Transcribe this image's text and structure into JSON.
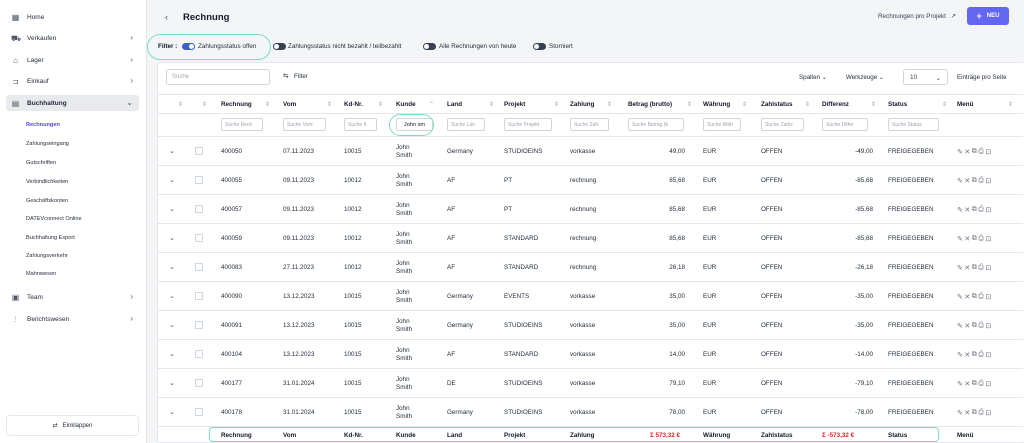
{
  "sidebar": {
    "items": [
      {
        "label": "Home",
        "icon": "grid-icon"
      },
      {
        "label": "Verkaufen",
        "icon": "cart-icon"
      },
      {
        "label": "Lager",
        "icon": "box-icon"
      },
      {
        "label": "Einkauf",
        "icon": "tag-icon"
      },
      {
        "label": "Buchhaltung",
        "icon": "ledger-icon"
      },
      {
        "label": "Team",
        "icon": "team-icon"
      },
      {
        "label": "Berichtswesen",
        "icon": "chart-icon"
      }
    ],
    "subitems": [
      "Rechnungen",
      "Zahlungseingang",
      "Gutschriften",
      "Verbindlichkeiten",
      "Geschäftskonten",
      "DATEVconnect Online",
      "Buchhaltung Export",
      "Zahlungsverkehr",
      "Mahnwesen"
    ],
    "collapse_label": "Einklappen"
  },
  "header": {
    "title": "Rechnung",
    "link": "Rechnungen pro Projekt",
    "new_label": "NEU"
  },
  "filters": {
    "label": "Filter :",
    "toggles": [
      {
        "label": "Zahlungsstatus offen",
        "on": true
      },
      {
        "label": "Zahlungsstatus nicht bezahlt / teilbezahlt",
        "on": false
      },
      {
        "label": "Alle Rechnungen von heute",
        "on": false
      },
      {
        "label": "Storniert",
        "on": false
      }
    ]
  },
  "toolbar": {
    "search_placeholder": "Suche",
    "filter_label": "Filter",
    "columns_label": "Spalten",
    "tools_label": "Werkzeuge",
    "page_size": "10",
    "page_size_label": "Einträge pro Seite"
  },
  "table": {
    "headers": [
      "Rechnung",
      "Vom",
      "Kd-Nr.",
      "Kunde",
      "Land",
      "Projekt",
      "Zahlung",
      "Betrag (brutto)",
      "Währung",
      "Zahlstatus",
      "Differenz",
      "Status",
      "Menü"
    ],
    "filter_placeholders": [
      "Suche Rech",
      "Suche Vom",
      "Suche K",
      "John sm",
      "Suche Lan",
      "Suche Projekt",
      "Suche Zah",
      "Suche Betrag (b",
      "Suche Wäh",
      "Suche Zahls",
      "Suche Differ",
      "Suche Status"
    ],
    "rows": [
      {
        "rechnung": "400050",
        "vom": "07.11.2023",
        "kdnr": "10015",
        "kunde": "John Smith",
        "land": "Germany",
        "projekt": "STUDIOEINS",
        "zahlung": "vorkasse",
        "betrag": "49,00",
        "waehrung": "EUR",
        "zahlstatus": "OFFEN",
        "differenz": "-49,00",
        "status": "FREIGEGEBEN"
      },
      {
        "rechnung": "400055",
        "vom": "09.11.2023",
        "kdnr": "10012",
        "kunde": "John Smith",
        "land": "AF",
        "projekt": "PT",
        "zahlung": "rechnung",
        "betrag": "85,68",
        "waehrung": "EUR",
        "zahlstatus": "OFFEN",
        "differenz": "-85,68",
        "status": "FREIGEGEBEN"
      },
      {
        "rechnung": "400057",
        "vom": "09.11.2023",
        "kdnr": "10012",
        "kunde": "John Smith",
        "land": "AF",
        "projekt": "PT",
        "zahlung": "rechnung",
        "betrag": "85,68",
        "waehrung": "EUR",
        "zahlstatus": "OFFEN",
        "differenz": "-85,68",
        "status": "FREIGEGEBEN"
      },
      {
        "rechnung": "400059",
        "vom": "09.11.2023",
        "kdnr": "10012",
        "kunde": "John Smith",
        "land": "AF",
        "projekt": "STANDARD",
        "zahlung": "rechnung",
        "betrag": "85,68",
        "waehrung": "EUR",
        "zahlstatus": "OFFEN",
        "differenz": "-85,68",
        "status": "FREIGEGEBEN"
      },
      {
        "rechnung": "400083",
        "vom": "27.11.2023",
        "kdnr": "10012",
        "kunde": "John Smith",
        "land": "AF",
        "projekt": "STANDARD",
        "zahlung": "rechnung",
        "betrag": "26,18",
        "waehrung": "EUR",
        "zahlstatus": "OFFEN",
        "differenz": "-26,18",
        "status": "FREIGEGEBEN"
      },
      {
        "rechnung": "400090",
        "vom": "13.12.2023",
        "kdnr": "10015",
        "kunde": "John Smith",
        "land": "Germany",
        "projekt": "EVENTS",
        "zahlung": "vorkasse",
        "betrag": "35,00",
        "waehrung": "EUR",
        "zahlstatus": "OFFEN",
        "differenz": "-35,00",
        "status": "FREIGEGEBEN"
      },
      {
        "rechnung": "400091",
        "vom": "13.12.2023",
        "kdnr": "10015",
        "kunde": "John Smith",
        "land": "Germany",
        "projekt": "STUDIOEINS",
        "zahlung": "vorkasse",
        "betrag": "35,00",
        "waehrung": "EUR",
        "zahlstatus": "OFFEN",
        "differenz": "-35,00",
        "status": "FREIGEGEBEN"
      },
      {
        "rechnung": "400104",
        "vom": "13.12.2023",
        "kdnr": "10015",
        "kunde": "John Smith",
        "land": "AF",
        "projekt": "STANDARD",
        "zahlung": "vorkasse",
        "betrag": "14,00",
        "waehrung": "EUR",
        "zahlstatus": "OFFEN",
        "differenz": "-14,00",
        "status": "FREIGEGEBEN"
      },
      {
        "rechnung": "400177",
        "vom": "31.01.2024",
        "kdnr": "10015",
        "kunde": "John Smith",
        "land": "DE",
        "projekt": "STUDIOEINS",
        "zahlung": "vorkasse",
        "betrag": "79,10",
        "waehrung": "EUR",
        "zahlstatus": "OFFEN",
        "differenz": "-79,10",
        "status": "FREIGEGEBEN"
      },
      {
        "rechnung": "400178",
        "vom": "31.01.2024",
        "kdnr": "10015",
        "kunde": "John Smith",
        "land": "Germany",
        "projekt": "STUDIOEINS",
        "zahlung": "vorkasse",
        "betrag": "78,00",
        "waehrung": "EUR",
        "zahlstatus": "OFFEN",
        "differenz": "-78,00",
        "status": "FREIGEGEBEN"
      }
    ],
    "footer": {
      "rechnung": "Rechnung",
      "vom": "Vom",
      "kdnr": "Kd-Nr.",
      "kunde": "Kunde",
      "land": "Land",
      "projekt": "Projekt",
      "zahlung": "Zahlung",
      "betrag_sum": "Σ 573,32 €",
      "waehrung": "Währung",
      "zahlstatus": "Zahlstatus",
      "differenz_sum": "Σ -573,32 €",
      "status": "Status",
      "menu": "Menü"
    }
  },
  "colors": {
    "accent": "#6366f1",
    "highlight_ring": "#7fdcc0",
    "negative_sum": "#dc2626"
  }
}
